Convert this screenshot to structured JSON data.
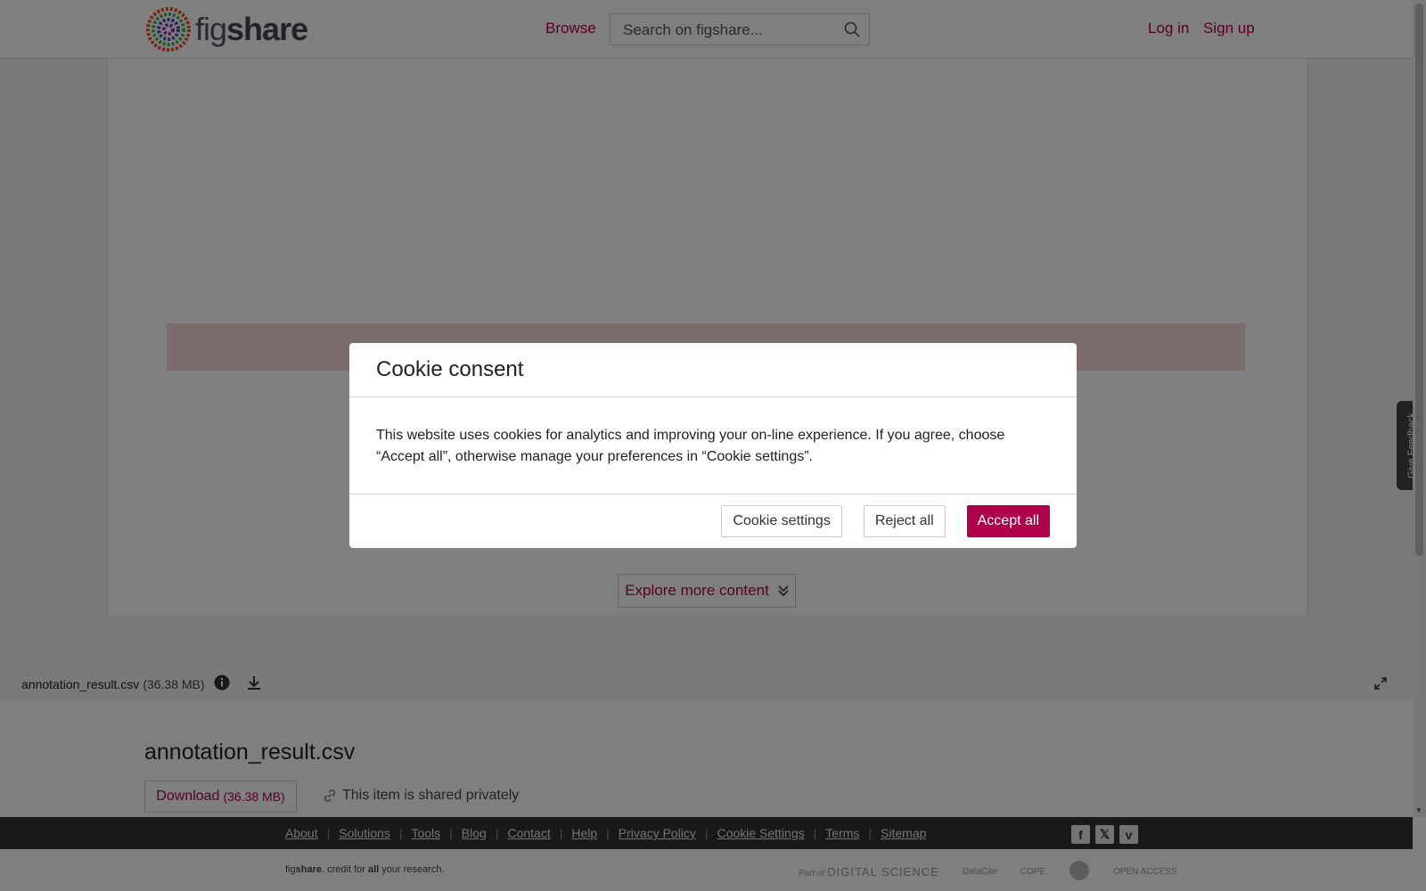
{
  "header": {
    "logo_text_fig": "fig",
    "logo_text_share": "share",
    "browse_label": "Browse",
    "search_placeholder": "Search on figshare...",
    "login_label": "Log in",
    "signup_label": "Sign up"
  },
  "viewer": {
    "explore_label": "Explore more content",
    "file_name": "annotation_result.csv",
    "file_size": "(36.38 MB)"
  },
  "item": {
    "title": "annotation_result.csv",
    "download_label": "Download",
    "download_size": "(36.38 MB)",
    "shared_text": "This item is shared privately"
  },
  "footer": {
    "links": [
      "About",
      "Solutions",
      "Tools",
      "Blog",
      "Contact",
      "Help",
      "Privacy Policy",
      "Cookie Settings",
      "Terms",
      "Sitemap"
    ],
    "social": [
      "f",
      "𝕏",
      "v"
    ],
    "tagline_fig": "fig",
    "tagline_share": "share",
    "tagline_rest_1": ". credit for ",
    "tagline_all": "all",
    "tagline_rest_2": " your research.",
    "partner_ds_prefix": "Part of",
    "partner_ds": "DIGITAL SCIENCE",
    "partner_datacite": "DataCite",
    "partner_cope": "COPE",
    "partner_open_access": "OPEN ACCESS"
  },
  "feedback_label": "Give Feedback",
  "modal": {
    "title": "Cookie consent",
    "body": "This website uses cookies for analytics and improving your on-line experience. If you agree, choose “Accept all”, otherwise manage your preferences in “Cookie settings”.",
    "settings_label": "Cookie settings",
    "reject_label": "Reject all",
    "accept_label": "Accept all"
  },
  "colors": {
    "accent": "#b0004b",
    "overlay": "rgba(0,0,0,0.5)"
  }
}
